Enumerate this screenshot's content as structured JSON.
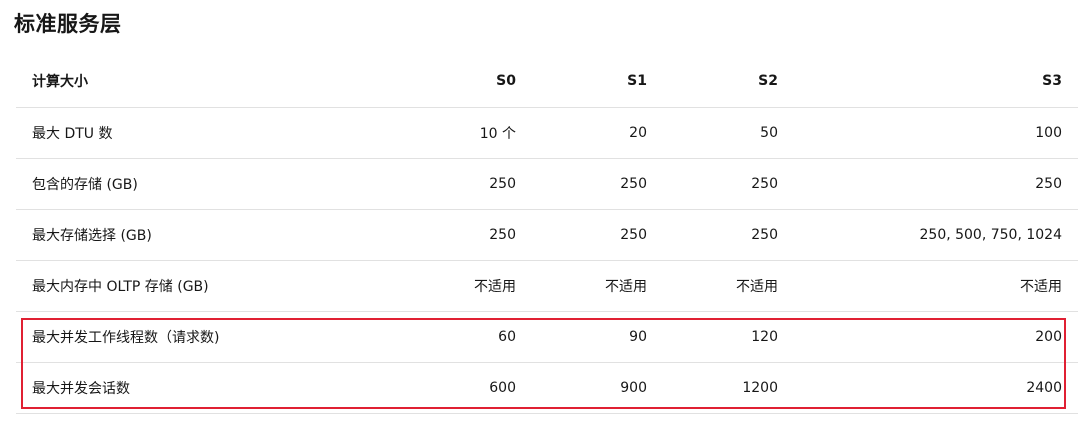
{
  "page": {
    "title": "标准服务层"
  },
  "table": {
    "headers": [
      "计算大小",
      "S0",
      "S1",
      "S2",
      "S3"
    ],
    "rows": [
      {
        "label": "最大 DTU 数",
        "values": [
          "10 个",
          "20",
          "50",
          "100"
        ]
      },
      {
        "label": "包含的存储 (GB)",
        "values": [
          "250",
          "250",
          "250",
          "250"
        ]
      },
      {
        "label": "最大存储选择 (GB)",
        "values": [
          "250",
          "250",
          "250",
          "250, 500, 750, 1024"
        ]
      },
      {
        "label": "最大内存中 OLTP 存储 (GB)",
        "values": [
          "不适用",
          "不适用",
          "不适用",
          "不适用"
        ]
      },
      {
        "label": "最大并发工作线程数（请求数)",
        "values": [
          "60",
          "90",
          "120",
          "200"
        ]
      },
      {
        "label": "最大并发会话数",
        "values": [
          "600",
          "900",
          "1200",
          "2400"
        ]
      }
    ]
  },
  "highlight": {
    "color": "#e02033",
    "rows": [
      5,
      6
    ]
  }
}
